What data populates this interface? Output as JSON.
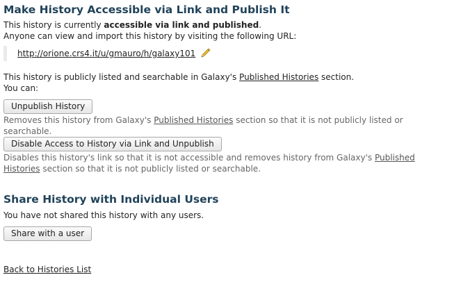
{
  "sections": {
    "publish": {
      "title": "Make History Accessible via Link and Publish It",
      "status_prefix": "This history is currently ",
      "status_bold": "accessible via link and published",
      "status_suffix": ".",
      "url_intro": "Anyone can view and import this history by visiting the following URL:",
      "url": "http://orione.crs4.it/u/gmauro/h/galaxy101",
      "listed_prefix": "This history is publicly listed and searchable in Galaxy's ",
      "listed_link": "Published Histories",
      "listed_suffix": " section.",
      "you_can": "You can:",
      "unpublish_button": "Unpublish History",
      "unpublish_desc_prefix": "Removes this history from Galaxy's ",
      "unpublish_desc_link": "Published Histories",
      "unpublish_desc_suffix": " section so that it is not publicly listed or searchable.",
      "disable_button": "Disable Access to History via Link and Unpublish",
      "disable_desc_prefix": "Disables this history's link so that it is not accessible and removes history from Galaxy's ",
      "disable_desc_link": "Published Histories",
      "disable_desc_suffix": " section so that it is not publicly listed or searchable."
    },
    "share": {
      "title": "Share History with Individual Users",
      "status": "You have not shared this history with any users.",
      "share_button": "Share with a user"
    }
  },
  "footer": {
    "back_link": "Back to Histories List"
  },
  "icons": {
    "edit_url": "pencil-icon"
  }
}
